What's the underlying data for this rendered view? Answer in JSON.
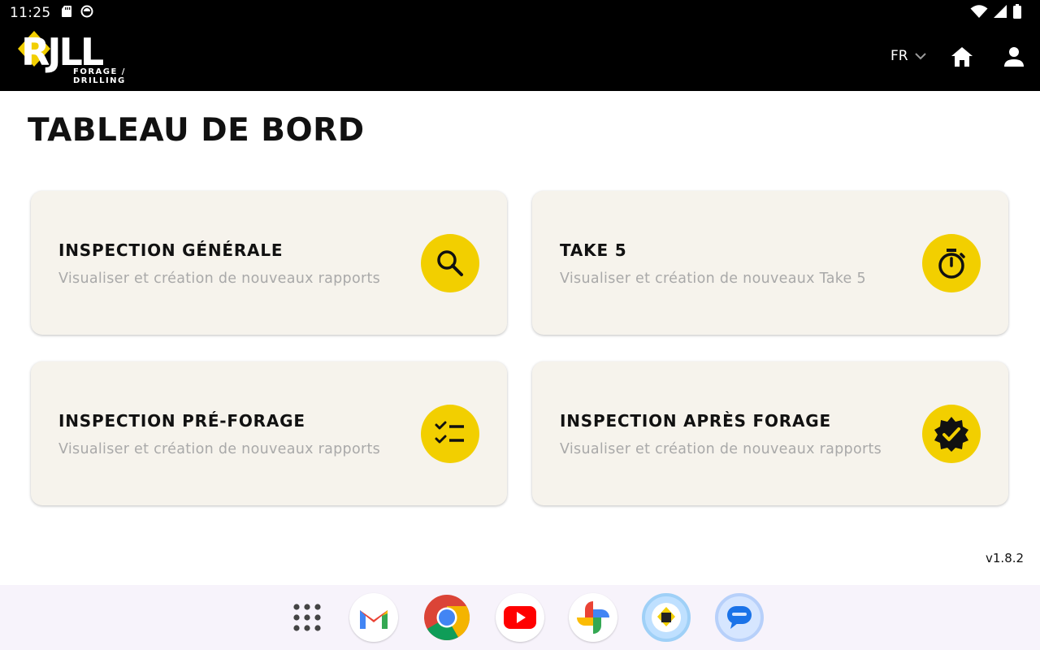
{
  "status_bar": {
    "time": "11:25"
  },
  "header": {
    "logo_text": "RJLL",
    "logo_sub_1": "FORAGE /",
    "logo_sub_2": "DRILLING",
    "language": "FR"
  },
  "page": {
    "title": "TABLEAU DE BORD"
  },
  "cards": [
    {
      "title": "INSPECTION GÉNÉRALE",
      "description": "Visualiser et création de nouveaux rapports",
      "icon": "search-icon"
    },
    {
      "title": "TAKE 5",
      "description": "Visualiser et création de nouveaux Take 5",
      "icon": "stopwatch-icon"
    },
    {
      "title": "INSPECTION PRÉ-FORAGE",
      "description": "Visualiser et création de nouveaux rapports",
      "icon": "checklist-icon"
    },
    {
      "title": "INSPECTION APRÈS FORAGE",
      "description": "Visualiser et création de nouveaux rapports",
      "icon": "verified-badge-icon"
    }
  ],
  "version": "v1.8.2",
  "dock": {
    "apps": [
      "app-drawer-icon",
      "gmail-icon",
      "chrome-icon",
      "youtube-icon",
      "photos-icon",
      "rjll-app-icon",
      "messages-icon"
    ]
  },
  "colors": {
    "accent": "#f2cf00",
    "header_bg": "#000000",
    "card_bg": "#f6f3ec",
    "description_text": "#a9a9a9"
  }
}
